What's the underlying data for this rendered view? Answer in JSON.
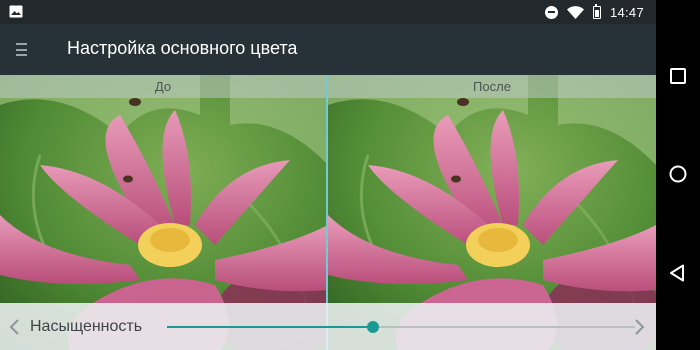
{
  "status_bar": {
    "time": "14:47",
    "icons": [
      "gallery-notification-icon",
      "do-not-disturb-icon",
      "wifi-icon",
      "battery-icon"
    ]
  },
  "app_bar": {
    "title": "Настройка основного цвета",
    "menu_icon": "menu-icon"
  },
  "preview": {
    "before_label": "До",
    "after_label": "После",
    "subject": "pink lotus flower"
  },
  "control": {
    "label": "Насыщенность",
    "slider_value": 0.44,
    "prev_icon": "chevron-left-icon",
    "next_icon": "chevron-right-icon"
  },
  "nav_bar": {
    "buttons": [
      "recents-button",
      "home-button",
      "back-button"
    ]
  },
  "colors": {
    "accent": "#1a9a93",
    "app_bar": "#263238",
    "status_bar": "#22282c",
    "divider": "#74c9d2"
  }
}
